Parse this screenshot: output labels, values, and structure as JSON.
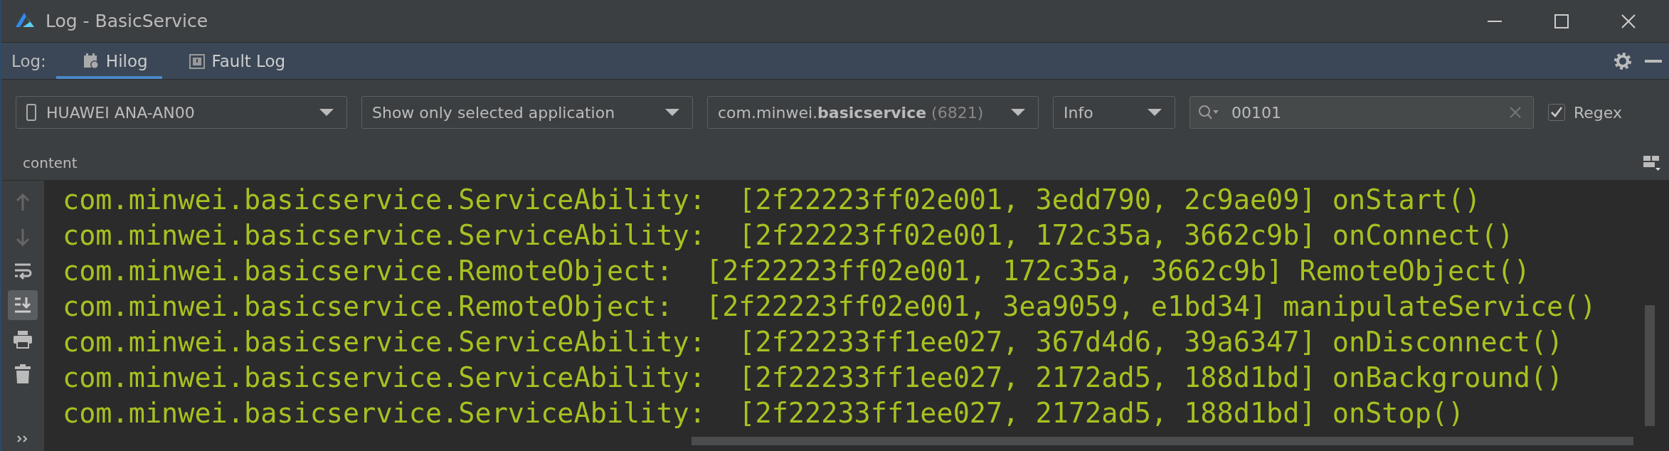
{
  "window": {
    "title": "Log - BasicService"
  },
  "log_tabs": {
    "label": "Log:",
    "tabs": [
      {
        "label": "Hilog",
        "selected": true
      },
      {
        "label": "Fault Log",
        "selected": false
      }
    ]
  },
  "filters": {
    "device": "HUAWEI ANA-AN00",
    "scope": "Show only selected application",
    "package": "com.minwei.**basicservice**",
    "pid": "(6821)",
    "level": "Info",
    "search": {
      "value": "00101"
    },
    "regex": {
      "label": "Regex",
      "checked": true
    }
  },
  "column_header": "content",
  "log_lines": [
    "com.minwei.basicservice.ServiceAbility:  [2f22223ff02e001, 3edd790, 2c9ae09] onStart()",
    "com.minwei.basicservice.ServiceAbility:  [2f22223ff02e001, 172c35a, 3662c9b] onConnect()",
    "com.minwei.basicservice.RemoteObject:  [2f22223ff02e001, 172c35a, 3662c9b] RemoteObject()",
    "com.minwei.basicservice.RemoteObject:  [2f22223ff02e001, 3ea9059, e1bd34] manipulateService()",
    "com.minwei.basicservice.ServiceAbility:  [2f22233ff1ee027, 367d4d6, 39a6347] onDisconnect()",
    "com.minwei.basicservice.ServiceAbility:  [2f22233ff1ee027, 2172ad5, 188d1bd] onBackground()",
    "com.minwei.basicservice.ServiceAbility:  [2f22233ff1ee027, 2172ad5, 188d1bd] onStop()"
  ],
  "side_tools": {
    "scroll_to_end": true
  }
}
